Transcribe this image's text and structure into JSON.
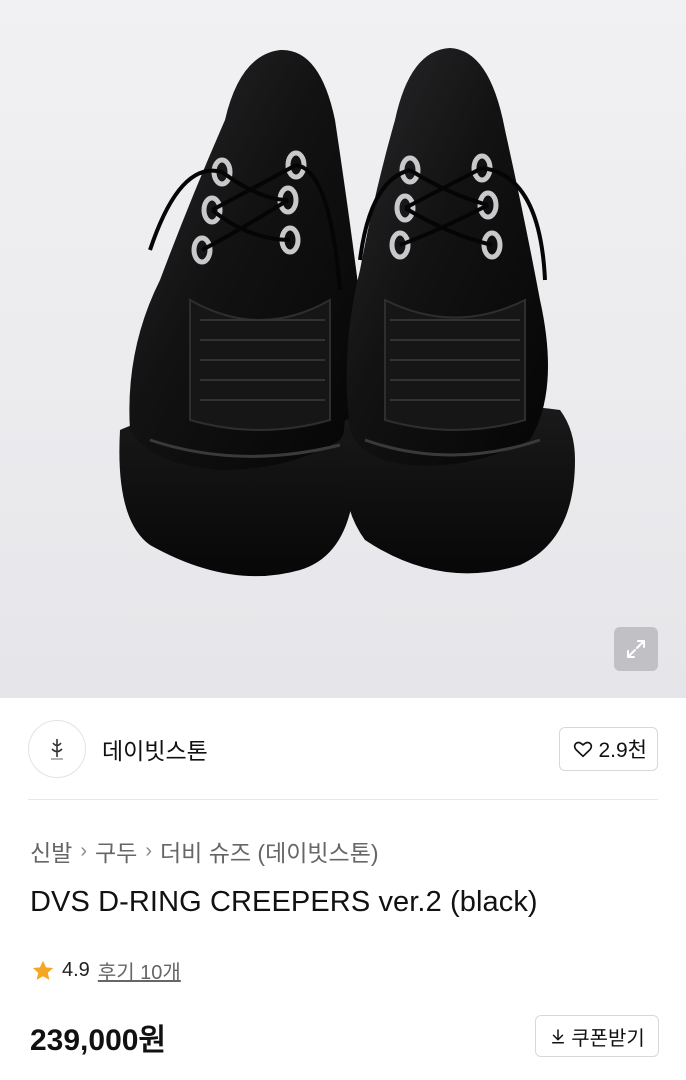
{
  "image": {
    "alt": "DVS D-RING CREEPERS ver.2 (black)"
  },
  "icons": {
    "expand": "expand-icon",
    "heart": "heart-icon",
    "star": "star-icon",
    "download": "download-icon"
  },
  "colors": {
    "star": "#f5a623",
    "price": "#111111",
    "muted": "#666666"
  },
  "store": {
    "name": "데이빗스톤",
    "likes_label": "2.9천"
  },
  "breadcrumb": {
    "items": [
      "신발",
      "구두",
      "더비 슈즈 (데이빗스톤)"
    ]
  },
  "product": {
    "title": "DVS D-RING CREEPERS ver.2 (black)",
    "rating": "4.9",
    "reviews_label": "후기 10개",
    "price": "239,000원",
    "coupon_label": "쿠폰받기"
  }
}
